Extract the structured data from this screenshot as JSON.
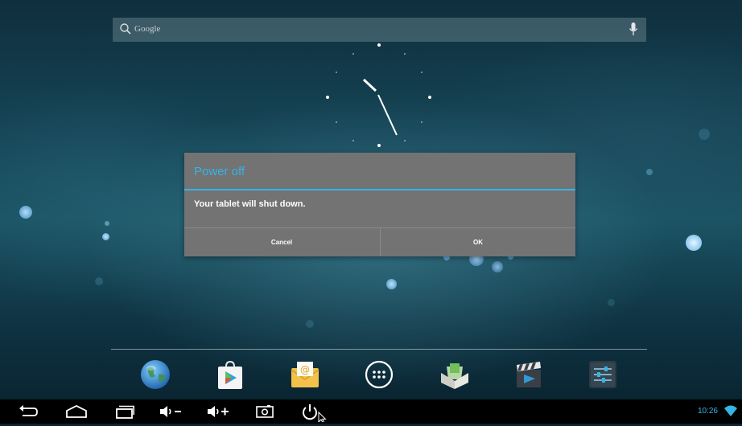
{
  "search": {
    "placeholder": "Google",
    "icons": [
      "search-icon",
      "microphone-icon"
    ]
  },
  "dialog": {
    "title": "Power off",
    "message": "Your tablet will shut down.",
    "cancel_label": "Cancel",
    "ok_label": "OK"
  },
  "dock": {
    "apps": [
      {
        "name": "browser",
        "icon": "globe-icon"
      },
      {
        "name": "play-store",
        "icon": "play-store-bag-icon"
      },
      {
        "name": "email",
        "icon": "email-envelope-icon"
      },
      {
        "name": "all-apps",
        "icon": "app-drawer-grid-icon"
      },
      {
        "name": "file-manager",
        "icon": "box-of-files-icon"
      },
      {
        "name": "video",
        "icon": "clapperboard-icon"
      },
      {
        "name": "settings",
        "icon": "settings-sliders-icon"
      }
    ]
  },
  "navbar": {
    "buttons": [
      "back-icon",
      "home-icon",
      "recent-apps-icon",
      "volume-down-icon",
      "volume-up-icon",
      "screenshot-icon",
      "power-icon"
    ]
  },
  "status": {
    "time": "10:26",
    "wifi_icon": "wifi-icon"
  },
  "colors": {
    "accent": "#33b5e5",
    "dialog_bg": "#737373",
    "navbar_bg": "#000000"
  }
}
